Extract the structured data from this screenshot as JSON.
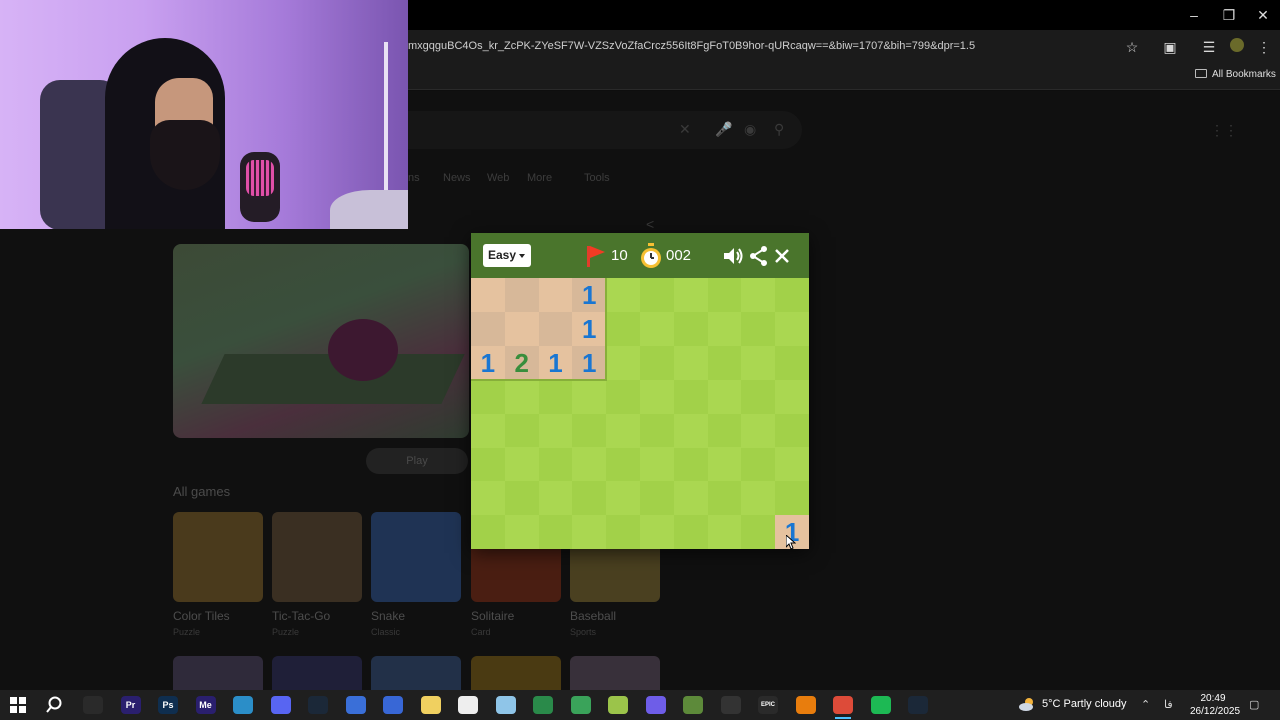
{
  "browser": {
    "url": "mxgqguBC4Os_kr_ZcPK-ZYeSF7W-VZSzVoZfaCrcz556It8FgFoT0B9hor-qURcaqw==&biw=1707&bih=799&dpr=1.5",
    "bookmarks_label": "All Bookmarks"
  },
  "google": {
    "tabs": [
      "ns",
      "News",
      "Web",
      "More",
      "Tools"
    ],
    "play_label": "Play",
    "all_games_label": "All games",
    "games": [
      {
        "name": "Color Tiles",
        "category": "Puzzle",
        "color": "#4a3a1c"
      },
      {
        "name": "Tic-Tac-Go",
        "category": "Puzzle",
        "color": "#3a2f22"
      },
      {
        "name": "Snake",
        "category": "Classic",
        "color": "#1f3354"
      },
      {
        "name": "Solitaire",
        "category": "Card",
        "color": "#4a1e12"
      },
      {
        "name": "Baseball",
        "category": "Sports",
        "color": "#4a4020"
      }
    ]
  },
  "minesweeper": {
    "difficulty": "Easy",
    "flags": "10",
    "timer": "002",
    "colors": {
      "header": "#4a752c",
      "grass_light": "#aad751",
      "grass_dark": "#a2d149",
      "dirt_light": "#e5c29f",
      "dirt_dark": "#d7b899",
      "one": "#1976d2",
      "two": "#388e3c"
    },
    "cells": [
      {
        "row": 0,
        "col": 0,
        "revealed": true,
        "value": ""
      },
      {
        "row": 0,
        "col": 1,
        "revealed": true,
        "value": ""
      },
      {
        "row": 0,
        "col": 2,
        "revealed": true,
        "value": ""
      },
      {
        "row": 0,
        "col": 3,
        "revealed": true,
        "value": "1"
      },
      {
        "row": 1,
        "col": 0,
        "revealed": true,
        "value": ""
      },
      {
        "row": 1,
        "col": 1,
        "revealed": true,
        "value": ""
      },
      {
        "row": 1,
        "col": 2,
        "revealed": true,
        "value": ""
      },
      {
        "row": 1,
        "col": 3,
        "revealed": true,
        "value": "1"
      },
      {
        "row": 2,
        "col": 0,
        "revealed": true,
        "value": "1"
      },
      {
        "row": 2,
        "col": 1,
        "revealed": true,
        "value": "2"
      },
      {
        "row": 2,
        "col": 2,
        "revealed": true,
        "value": "1"
      },
      {
        "row": 2,
        "col": 3,
        "revealed": true,
        "value": "1"
      },
      {
        "row": 7,
        "col": 9,
        "revealed": true,
        "value": "1"
      }
    ]
  },
  "taskbar": {
    "weather": "5°C  Partly cloudy",
    "time": "20:49",
    "date": "26/12/2025",
    "apps": [
      {
        "label": "",
        "color": "#2a2a2a"
      },
      {
        "label": "Pr",
        "color": "#2a1f6e"
      },
      {
        "label": "Ps",
        "color": "#0f2e4f"
      },
      {
        "label": "Me",
        "color": "#2a1f6e"
      },
      {
        "label": "",
        "color": "#2b8ec8"
      },
      {
        "label": "",
        "color": "#5865f2"
      },
      {
        "label": "",
        "color": "#1b2838"
      },
      {
        "label": "",
        "color": "#3a6fd8"
      },
      {
        "label": "",
        "color": "#3867d6"
      },
      {
        "label": "",
        "color": "#f0d060"
      },
      {
        "label": "",
        "color": "#eeeeee"
      },
      {
        "label": "",
        "color": "#8fc5e8"
      },
      {
        "label": "",
        "color": "#2a8a4a"
      },
      {
        "label": "",
        "color": "#3aa35a"
      },
      {
        "label": "",
        "color": "#9bc44a"
      },
      {
        "label": "",
        "color": "#6e5de8"
      },
      {
        "label": "",
        "color": "#5d8a3a"
      },
      {
        "label": "",
        "color": "#333333"
      },
      {
        "label": "EPIC",
        "color": "#2a2a2a"
      },
      {
        "label": "",
        "color": "#e87d0d"
      },
      {
        "label": "",
        "color": "#dd4b39"
      },
      {
        "label": "",
        "color": "#1db954"
      },
      {
        "label": "",
        "color": "#1b2838"
      }
    ]
  }
}
